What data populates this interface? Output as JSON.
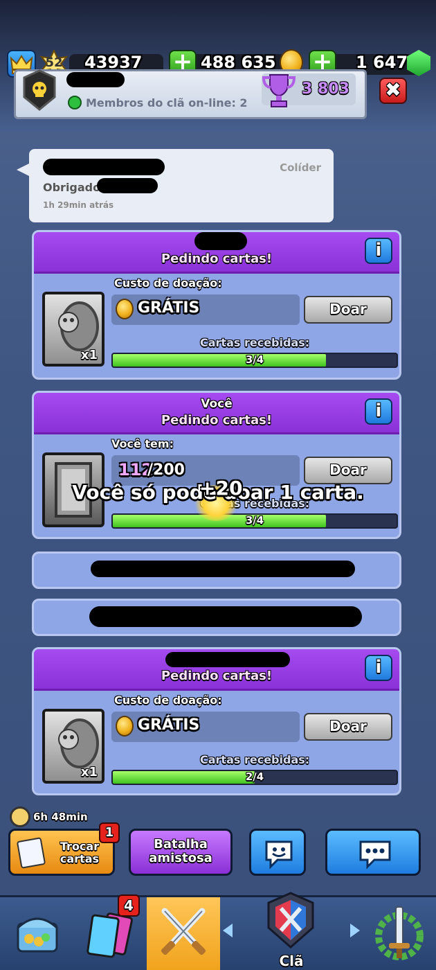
{
  "header": {
    "level": "52",
    "exp": "43937",
    "gold": "488 635",
    "gems": "1 647",
    "clan_online": "Membros do clã on-line: 2",
    "trophies": "3 803",
    "close_symbol": "✖",
    "plus_symbol": "+"
  },
  "chat": {
    "role": "Colíder",
    "message": "Obrigado",
    "time": "1h 29min atrás"
  },
  "requests": [
    {
      "title": "Pedindo cartas!",
      "cost_label": "Custo de doação:",
      "cost_value": "GRÁTIS",
      "donate_label": "Doar",
      "received_label": "Cartas recebidas:",
      "progress_text": "3/4",
      "progress": 0.75,
      "card_count": "x1",
      "card_icon": "skeleton-barrel-card"
    },
    {
      "who": "Você",
      "title": "Pedindo cartas!",
      "have_label": "Você tem:",
      "have_current": "112",
      "have_total": "/200",
      "donate_label": "Doar",
      "received_label": "Cartas recebidas:",
      "progress_text": "3/4",
      "progress": 0.75,
      "card_icon": "tombstone-card"
    },
    {
      "title": "Pedindo cartas!",
      "cost_label": "Custo de doação:",
      "cost_value": "GRÁTIS",
      "donate_label": "Doar",
      "received_label": "Cartas recebidas:",
      "progress_text": "2/4",
      "progress": 0.5,
      "card_count": "x1",
      "card_icon": "skeleton-barrel-card"
    }
  ],
  "overlay": {
    "toast": "Você só pode doar 1 carta.",
    "gain": "+20"
  },
  "footer": {
    "timer": "6h 48min",
    "trade_label": "Trocar cartas",
    "trade_badge": "1",
    "friendly_label": "Batalha amistosa",
    "emote_icon": "emote-icon",
    "chat_icon": "chat-icon"
  },
  "nav": {
    "cards_badge": "4",
    "clan_label": "Clã",
    "items": [
      "shop-chest-icon",
      "cards-icon",
      "battle-swords-icon",
      "clan-icon",
      "tournament-icon"
    ]
  },
  "colors": {
    "purple_header": "#9a40e6",
    "card_body": "#8ea6e6",
    "progress_green": "#53d22b",
    "doar_gray": "#bdbdbd",
    "orange_button": "#f7a52a",
    "blue_button": "#2f8ff0"
  }
}
